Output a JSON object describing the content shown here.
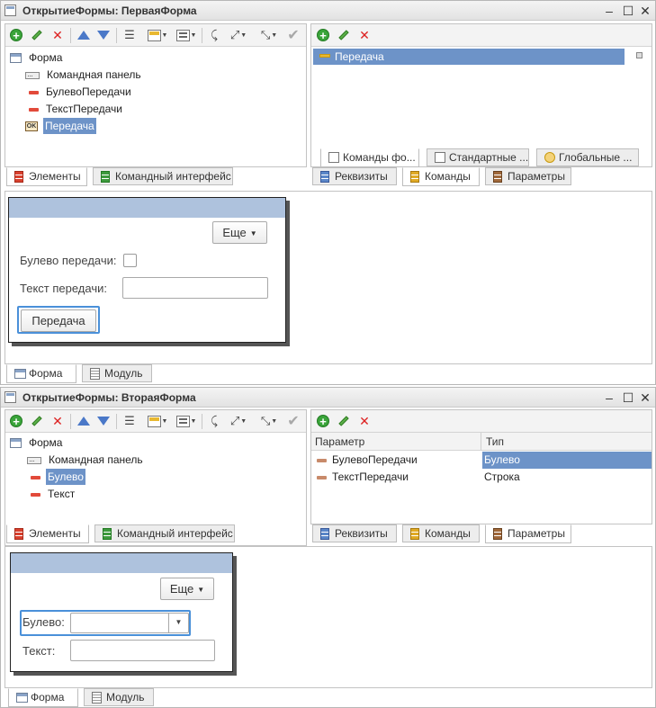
{
  "window1": {
    "title": "ОткрытиеФормы: ПерваяФорма",
    "tree": [
      {
        "label": "Форма",
        "icon": "form-icon"
      },
      {
        "label": "Командная панель",
        "icon": "command-bar-icon"
      },
      {
        "label": "БулевоПередачи",
        "icon": "field-icon"
      },
      {
        "label": "ТекстПередачи",
        "icon": "field-icon"
      },
      {
        "label": "Передача",
        "icon": "button-icon",
        "selected": true
      }
    ],
    "left_tabs": [
      "Элементы",
      "Командный интерфейс"
    ],
    "commands": [
      {
        "label": "Передача",
        "selected": true
      }
    ],
    "cmd_subtabs": [
      "Команды фо...",
      "Стандартные ...",
      "Глобальные ..."
    ],
    "right_tabs": [
      "Реквизиты",
      "Команды",
      "Параметры"
    ],
    "preview": {
      "more_label": "Еще",
      "bool_label": "Булево передачи:",
      "text_label": "Текст передачи:",
      "button_label": "Передача"
    },
    "bottom_tabs": [
      "Форма",
      "Модуль"
    ]
  },
  "window2": {
    "title": "ОткрытиеФормы: ВтораяФорма",
    "tree": [
      {
        "label": "Форма",
        "icon": "form-icon"
      },
      {
        "label": "Командная панель",
        "icon": "command-bar-icon"
      },
      {
        "label": "Булево",
        "icon": "field-icon",
        "selected": true
      },
      {
        "label": "Текст",
        "icon": "field-icon"
      }
    ],
    "left_tabs": [
      "Элементы",
      "Командный интерфейс"
    ],
    "params_header": {
      "col1": "Параметр",
      "col2": "Тип"
    },
    "params": [
      {
        "name": "БулевоПередачи",
        "type": "Булево"
      },
      {
        "name": "ТекстПередачи",
        "type": "Строка"
      }
    ],
    "right_tabs": [
      "Реквизиты",
      "Команды",
      "Параметры"
    ],
    "preview": {
      "more_label": "Еще",
      "bool_label": "Булево:",
      "text_label": "Текст:"
    },
    "bottom_tabs": [
      "Форма",
      "Модуль"
    ]
  },
  "colors": {
    "selection": "#6d93c8",
    "focus": "#4a90d9",
    "form_header": "#aec2dd"
  }
}
